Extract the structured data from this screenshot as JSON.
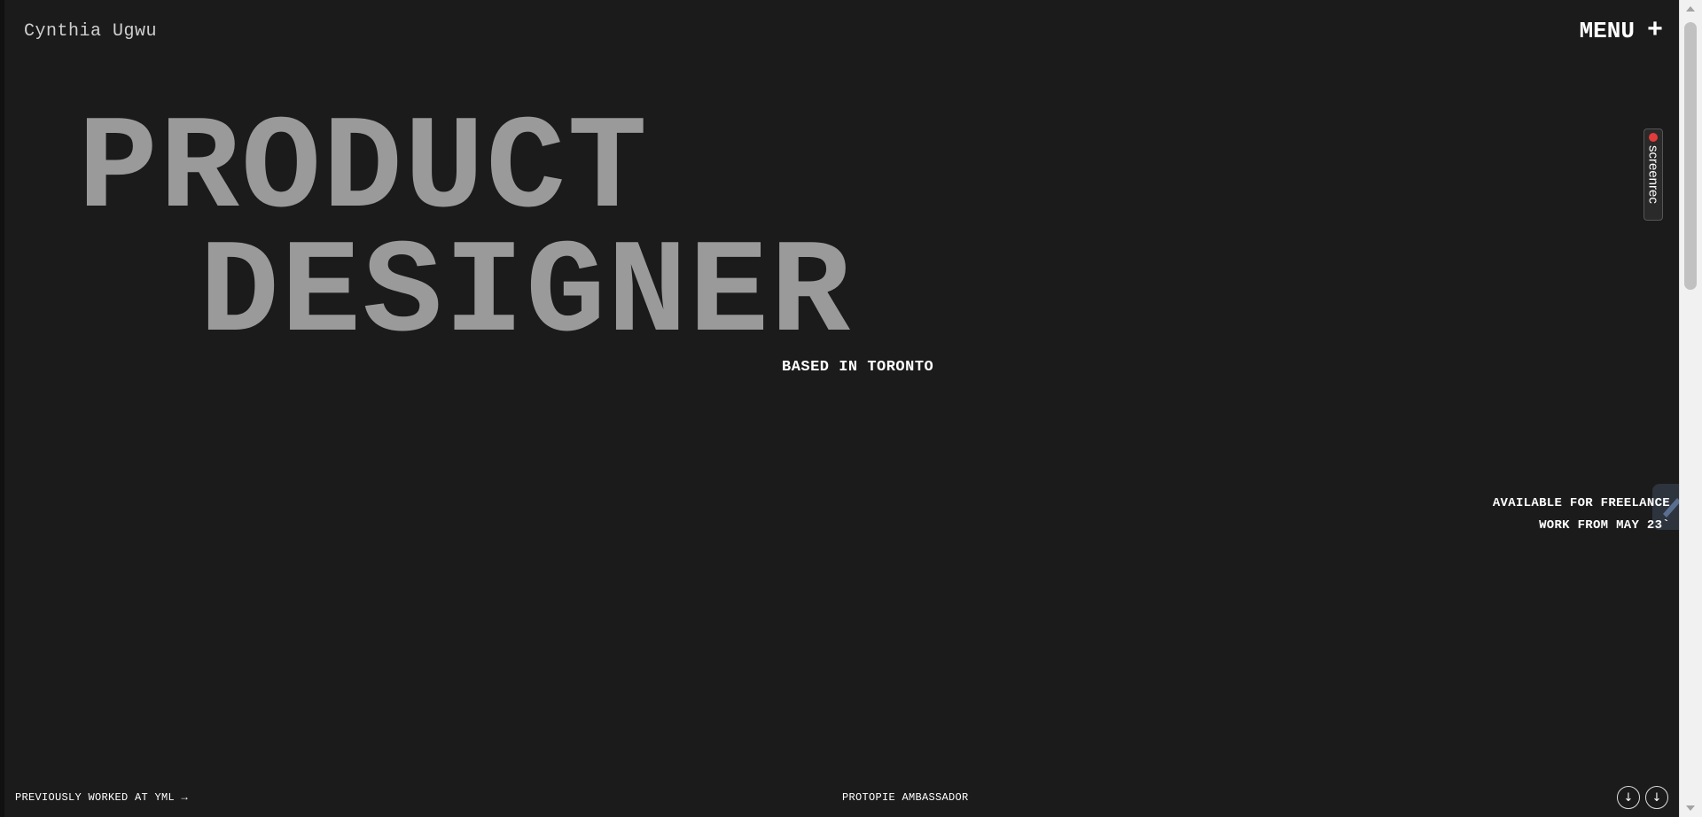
{
  "header": {
    "brand": "Cynthia Ugwu",
    "menu_label": "MENU",
    "menu_icon": "+"
  },
  "hero": {
    "line1": "PRODUCT",
    "line2": "DESIGNER",
    "location": "BASED IN TORONTO"
  },
  "availability": {
    "line1": "AVAILABLE FOR FREELANCE",
    "line2": "WORK FROM MAY 23`"
  },
  "screenrec": {
    "label": "screenrec"
  },
  "footer": {
    "previous": "PREVIOUSLY WORKED AT YML →",
    "ambassador": "PROTOPIE AMBASSADOR",
    "scroll_down_1": "↓",
    "scroll_down_2": "↓"
  },
  "colors": {
    "background": "#1b1b1b",
    "hero_text": "#9a9a9a",
    "text": "#ffffff",
    "record_dot": "#e23b3b"
  }
}
